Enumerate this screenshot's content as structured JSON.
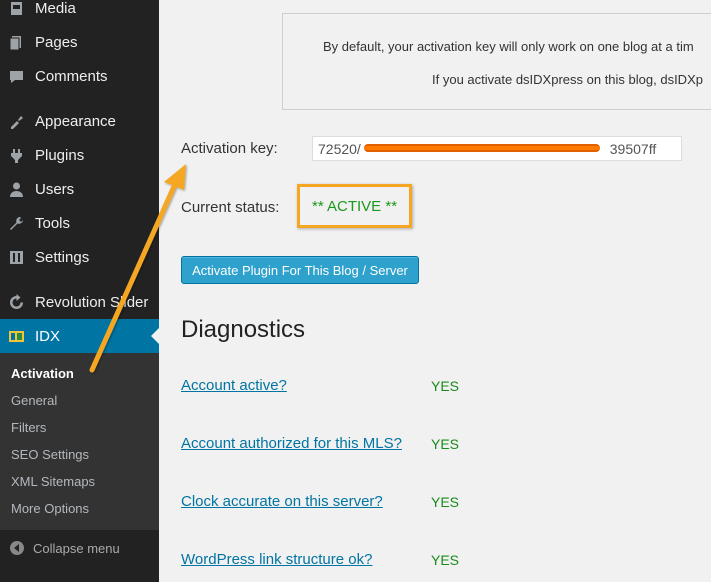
{
  "sidebar": {
    "items": [
      {
        "label": "Media",
        "icon": "media-icon"
      },
      {
        "label": "Pages",
        "icon": "pages-icon"
      },
      {
        "label": "Comments",
        "icon": "comments-icon"
      },
      {
        "label": "Appearance",
        "icon": "appearance-icon"
      },
      {
        "label": "Plugins",
        "icon": "plugins-icon"
      },
      {
        "label": "Users",
        "icon": "users-icon"
      },
      {
        "label": "Tools",
        "icon": "tools-icon"
      },
      {
        "label": "Settings",
        "icon": "settings-icon"
      },
      {
        "label": "Revolution Slider",
        "icon": "revolution-slider-icon"
      },
      {
        "label": "IDX",
        "icon": "idx-icon"
      }
    ],
    "submenu": [
      {
        "label": "Activation"
      },
      {
        "label": "General"
      },
      {
        "label": "Filters"
      },
      {
        "label": "SEO Settings"
      },
      {
        "label": "XML Sitemaps"
      },
      {
        "label": "More Options"
      }
    ],
    "collapse_label": "Collapse menu"
  },
  "notice": {
    "line1": "By default, your activation key will only work on one blog at a tim",
    "line2": "If you activate dsIDXpress on this blog, dsIDXp"
  },
  "activation": {
    "key_label": "Activation key:",
    "key_value": "72520/                                                                39507ff",
    "status_label": "Current status:",
    "status_value": "** ACTIVE **",
    "button_label": "Activate Plugin For This Blog / Server"
  },
  "diagnostics": {
    "title": "Diagnostics",
    "rows": [
      {
        "label": "Account active?",
        "value": "YES"
      },
      {
        "label": "Account authorized for this MLS?",
        "value": "YES"
      },
      {
        "label": "Clock accurate on this server?",
        "value": "YES"
      },
      {
        "label": "WordPress link structure ok?",
        "value": "YES"
      }
    ]
  },
  "colors": {
    "sidebar_bg": "#222222",
    "submenu_bg": "#333333",
    "current_menu": "#0074a2",
    "button": "#2ea2cc",
    "link": "#0074a2",
    "status_green": "#1a9a1a",
    "annotation_orange": "#f5a623"
  }
}
